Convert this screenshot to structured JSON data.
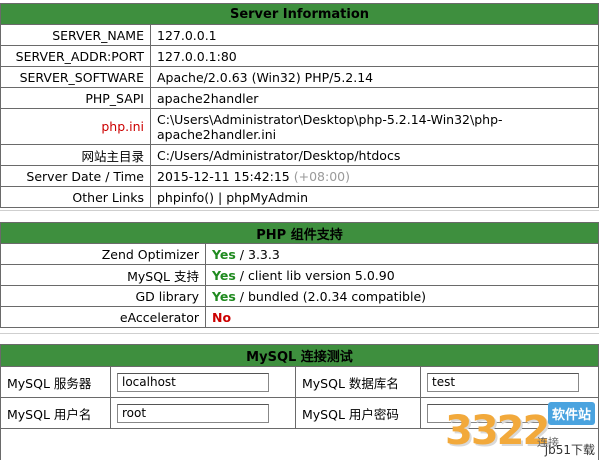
{
  "server_info": {
    "title": "Server Information",
    "rows": [
      {
        "label": "SERVER_NAME",
        "value": "127.0.0.1"
      },
      {
        "label": "SERVER_ADDR:PORT",
        "value": "127.0.0.1:80"
      },
      {
        "label": "SERVER_SOFTWARE",
        "value": "Apache/2.0.63 (Win32) PHP/5.2.14"
      },
      {
        "label": "PHP_SAPI",
        "value": "apache2handler"
      },
      {
        "label": "php.ini",
        "value_line1": "C:\\Users\\Administrator\\Desktop\\php-5.2.14-Win32\\php-",
        "value_line2": "apache2handler.ini"
      },
      {
        "label": "网站主目录",
        "value": "C:/Users/Administrator/Desktop/htdocs"
      },
      {
        "label": "Server Date / Time",
        "value": "2015-12-11 15:42:15",
        "extra": "(+08:00)"
      },
      {
        "label": "Other Links",
        "link1": "phpinfo()",
        "divider": "|",
        "link2": "phpMyAdmin"
      }
    ]
  },
  "php_support": {
    "title": "PHP 组件支持",
    "rows": [
      {
        "label": "Zend Optimizer",
        "status": "Yes",
        "detail": " / 3.3.3"
      },
      {
        "label": "MySQL 支持",
        "status": "Yes",
        "detail": " / client lib version 5.0.90"
      },
      {
        "label": "GD library",
        "status": "Yes",
        "detail": " / bundled (2.0.34 compatible)"
      },
      {
        "label": "eAccelerator",
        "status": "No",
        "detail": ""
      }
    ]
  },
  "mysql_test": {
    "title": "MySQL 连接测试",
    "host_label": "MySQL 服务器",
    "host_value": "localhost",
    "db_label": "MySQL 数据库名",
    "db_value": "test",
    "user_label": "MySQL 用户名",
    "user_value": "root",
    "pass_label": "MySQL 用户密码",
    "pass_value": ""
  },
  "watermark": {
    "number": "3322",
    "tag": "软件站",
    "sub": "jb51下载",
    "glyph": "连接"
  },
  "colors": {
    "header_bg": "#3e8f3e",
    "yes": "#1f8a1f",
    "no": "#cc0000",
    "highlight_label": "#cc0000"
  }
}
